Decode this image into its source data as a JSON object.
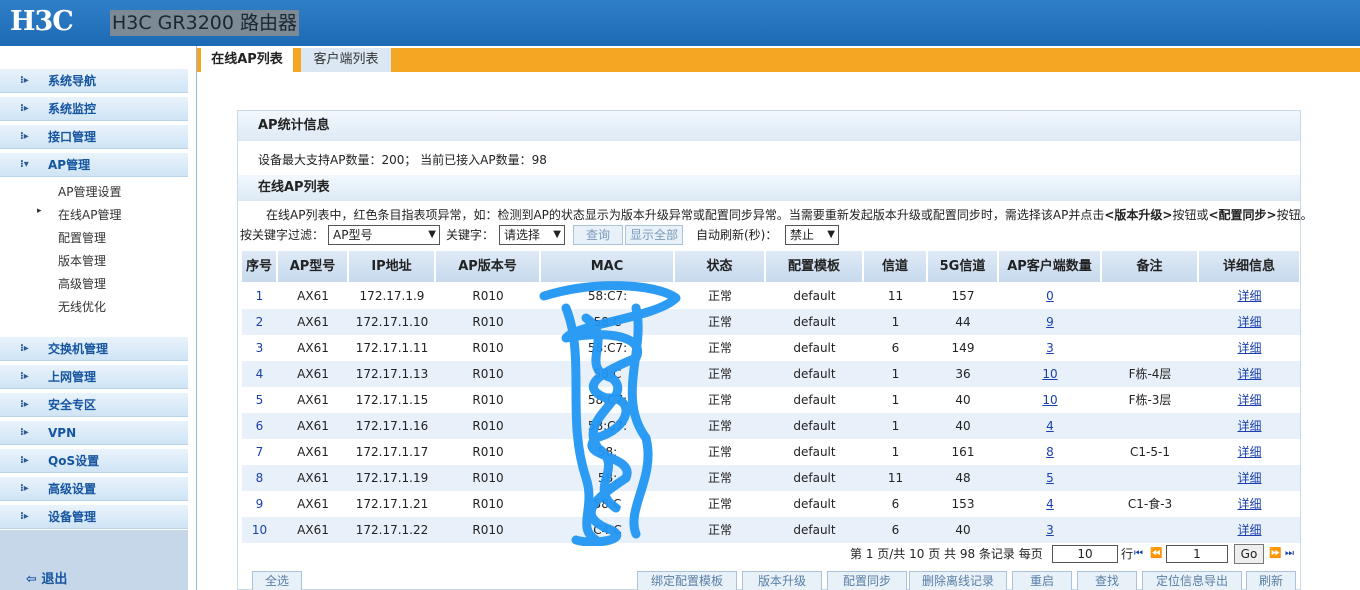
{
  "header": {
    "logo": "H3C",
    "product_title": "H3C GR3200 路由器"
  },
  "sidebar": {
    "items": [
      {
        "label": "系统导航"
      },
      {
        "label": "系统监控"
      },
      {
        "label": "接口管理"
      },
      {
        "label": "AP管理"
      },
      {
        "label": "交换机管理"
      },
      {
        "label": "上网管理"
      },
      {
        "label": "安全专区"
      },
      {
        "label": "VPN"
      },
      {
        "label": "QoS设置"
      },
      {
        "label": "高级设置"
      },
      {
        "label": "设备管理"
      }
    ],
    "ap_sub_items": [
      "AP管理设置",
      "在线AP管理",
      "配置管理",
      "版本管理",
      "高级管理",
      "无线优化"
    ],
    "logout": "退出"
  },
  "tabs": [
    {
      "label": "在线AP列表",
      "active": true
    },
    {
      "label": "客户端列表",
      "active": false
    }
  ],
  "stats": {
    "title": "AP统计信息",
    "text": "设备最大支持AP数量：200； 当前已接入AP数量：98"
  },
  "list": {
    "title": "在线AP列表",
    "desc_part1": "在线AP列表中，红色条目指表项异常，如：检测到AP的状态显示为版本升级异常或配置同步异常。当需要重新发起版本升级或配置同步时，需选择该AP并点击",
    "desc_btn1": "<版本升级>",
    "desc_part2": "按钮或",
    "desc_btn2": "<配置同步>",
    "desc_part3": "按钮。",
    "filter": {
      "filter_label": "按关键字过滤：",
      "filter_value": "AP型号",
      "keyword_label": "关键字：",
      "keyword_value": "请选择",
      "search_button": "查询",
      "show_all_button": "显示全部",
      "refresh_label": "自动刷新(秒)：",
      "refresh_value": "禁止"
    },
    "columns": [
      "序号",
      "AP型号",
      "IP地址",
      "AP版本号",
      "MAC",
      "状态",
      "配置模板",
      "信道",
      "5G信道",
      "AP客户端数量",
      "备注",
      "详细信息"
    ],
    "rows": [
      {
        "idx": "1",
        "model": "AX61",
        "ip": "172.17.1.9",
        "ver": "R010",
        "mac": "58:C7:",
        "status": "正常",
        "tmpl": "default",
        "ch": "11",
        "ch5g": "157",
        "clients": "0",
        "note": "",
        "detail": "详细"
      },
      {
        "idx": "2",
        "model": "AX61",
        "ip": "172.17.1.10",
        "ver": "R010",
        "mac": "58:C",
        "status": "正常",
        "tmpl": "default",
        "ch": "1",
        "ch5g": "44",
        "clients": "9",
        "note": "",
        "detail": "详细"
      },
      {
        "idx": "3",
        "model": "AX61",
        "ip": "172.17.1.11",
        "ver": "R010",
        "mac": "58:C7:",
        "status": "正常",
        "tmpl": "default",
        "ch": "6",
        "ch5g": "149",
        "clients": "3",
        "note": "",
        "detail": "详细"
      },
      {
        "idx": "4",
        "model": "AX61",
        "ip": "172.17.1.13",
        "ver": "R010",
        "mac": "58:C",
        "status": "正常",
        "tmpl": "default",
        "ch": "1",
        "ch5g": "36",
        "clients": "10",
        "note": "F栋-4层",
        "detail": "详细"
      },
      {
        "idx": "5",
        "model": "AX61",
        "ip": "172.17.1.15",
        "ver": "R010",
        "mac": "58:C7:",
        "status": "正常",
        "tmpl": "default",
        "ch": "1",
        "ch5g": "40",
        "clients": "10",
        "note": "F栋-3层",
        "detail": "详细"
      },
      {
        "idx": "6",
        "model": "AX61",
        "ip": "172.17.1.16",
        "ver": "R010",
        "mac": "58:C7:",
        "status": "正常",
        "tmpl": "default",
        "ch": "1",
        "ch5g": "40",
        "clients": "4",
        "note": "",
        "detail": "详细"
      },
      {
        "idx": "7",
        "model": "AX61",
        "ip": "172.17.1.17",
        "ver": "R010",
        "mac": "58:",
        "status": "正常",
        "tmpl": "default",
        "ch": "1",
        "ch5g": "161",
        "clients": "8",
        "note": "C1-5-1",
        "detail": "详细"
      },
      {
        "idx": "8",
        "model": "AX61",
        "ip": "172.17.1.19",
        "ver": "R010",
        "mac": "58:",
        "status": "正常",
        "tmpl": "default",
        "ch": "11",
        "ch5g": "48",
        "clients": "5",
        "note": "",
        "detail": "详细"
      },
      {
        "idx": "9",
        "model": "AX61",
        "ip": "172.17.1.21",
        "ver": "R010",
        "mac": "58:C",
        "status": "正常",
        "tmpl": "default",
        "ch": "6",
        "ch5g": "153",
        "clients": "4",
        "note": "C1-食-3",
        "detail": "详细"
      },
      {
        "idx": "10",
        "model": "AX61",
        "ip": "172.17.1.22",
        "ver": "R010",
        "mac": "C4:C",
        "status": "正常",
        "tmpl": "default",
        "ch": "6",
        "ch5g": "40",
        "clients": "3",
        "note": "",
        "detail": "详细"
      }
    ],
    "pager": {
      "summary": "第 1 页/共 10 页 共 98 条记录 每页",
      "per_page": "10",
      "rows_label": "行",
      "page_input": "1",
      "go": "Go"
    },
    "buttons": {
      "select_all": "全选",
      "bind_template": "绑定配置模板",
      "upgrade": "版本升级",
      "sync": "配置同步",
      "delete_offline": "删除离线记录",
      "restart": "重启",
      "find": "查找",
      "export_location": "定位信息导出",
      "refresh": "刷新"
    }
  },
  "colors": {
    "header_blue": "#1d6ab4",
    "tab_orange": "#f5a623",
    "link_blue": "#1a3fae",
    "scribble_blue": "#2196f3"
  }
}
